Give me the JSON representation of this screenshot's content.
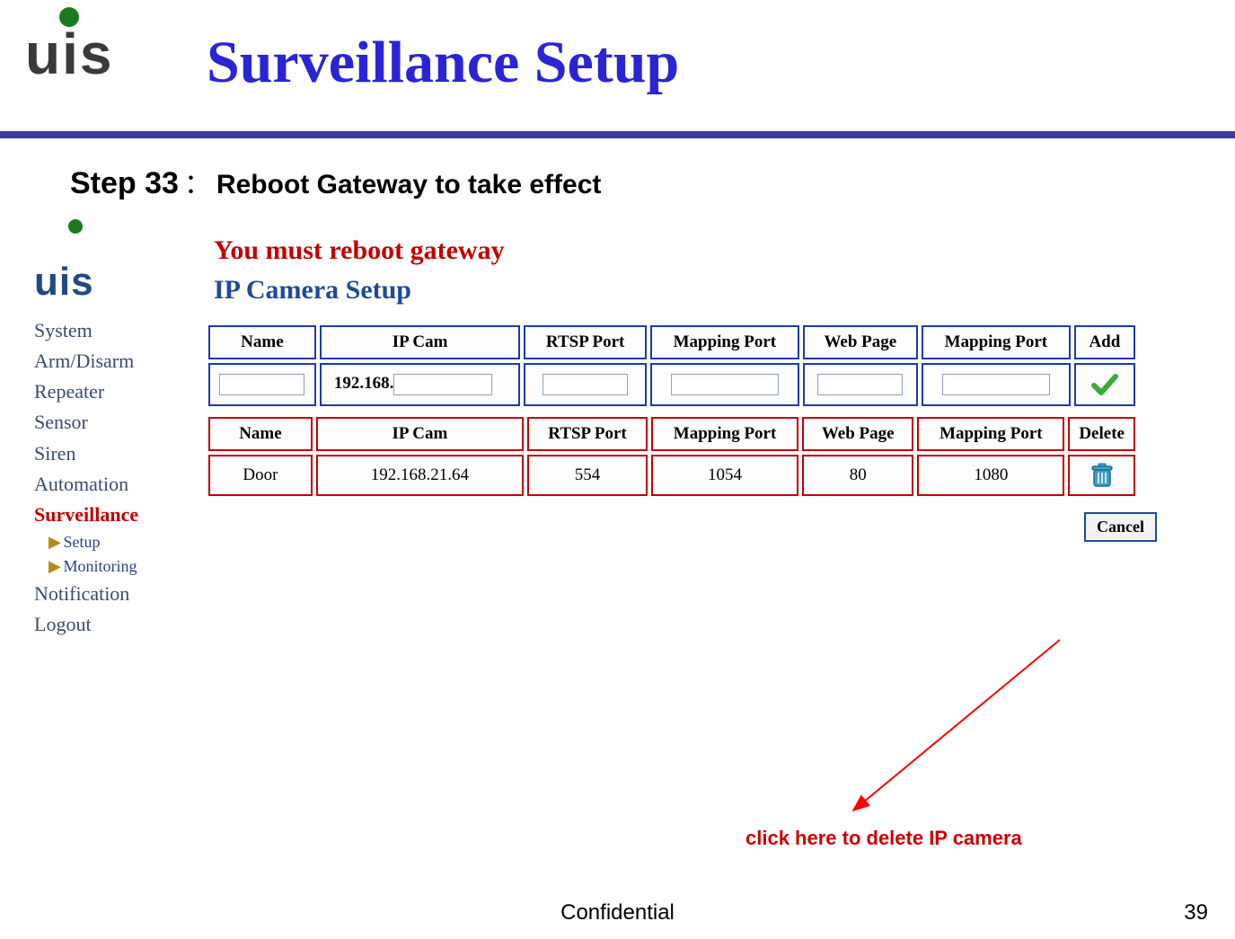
{
  "header": {
    "logo_text": "uis",
    "title": "Surveillance Setup"
  },
  "step": {
    "label": "Step 33",
    "colon": "：",
    "text": "Reboot Gateway to take effect"
  },
  "inner": {
    "logo_text": "uis",
    "warning": "You must reboot gateway",
    "section_title": "IP Camera Setup",
    "sidenav": {
      "items": [
        "System",
        "Arm/Disarm",
        "Repeater",
        "Sensor",
        "Siren",
        "Automation",
        "Surveillance",
        "Notification",
        "Logout"
      ],
      "active_index": 6,
      "sub": [
        "Setup",
        "Monitoring"
      ]
    },
    "add_table": {
      "headers": [
        "Name",
        "IP Cam",
        "RTSP Port",
        "Mapping Port",
        "Web Page",
        "Mapping Port",
        "Add"
      ],
      "ip_prefix": "192.168."
    },
    "del_table": {
      "headers": [
        "Name",
        "IP Cam",
        "RTSP Port",
        "Mapping Port",
        "Web Page",
        "Mapping Port",
        "Delete"
      ],
      "row": {
        "name": "Door",
        "ip_cam": "192.168.21.64",
        "rtsp_port": "554",
        "mapping_port": "1054",
        "web_page": "80",
        "mapping_port2": "1080"
      }
    },
    "cancel_label": "Cancel"
  },
  "annotation": "click here to delete IP camera",
  "footer": {
    "confidential": "Confidential",
    "page": "39"
  }
}
